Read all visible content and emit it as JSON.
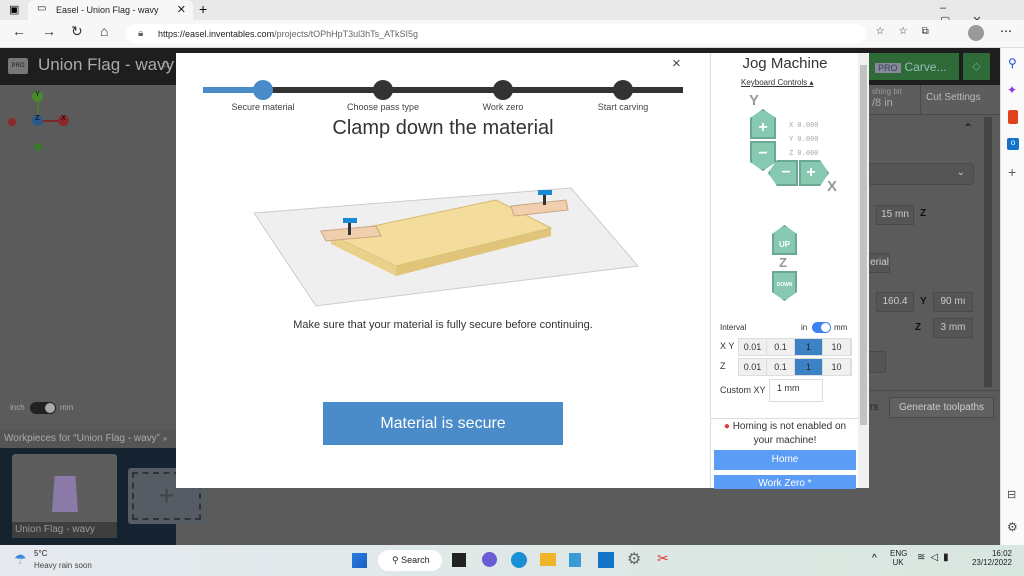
{
  "browser": {
    "tab_title": "Easel - Union Flag - wavy",
    "url_host": "https://easel.inventables.com",
    "url_path": "/projects/tOPhHpT3ul3hTs_ATkSI5g"
  },
  "app": {
    "project_title": "Union Flag - wavy",
    "pro_badge": "PRO",
    "carve_label": "Carve...",
    "bit_label": "shing bit",
    "bit_value": "/8 in",
    "cut_settings": "Cut Settings",
    "depth_value": "15 mn",
    "z_label": "Z",
    "material_label": "erial",
    "x_value": "160.4",
    "y_label": "Y",
    "y_value": "90 mı",
    "z_value": "3 mm",
    "generate_toolpaths": "Generate toolpaths",
    "units_inch": "inch",
    "units_mm": "mm",
    "workpieces_label": "Workpieces for “Union Flag - wavy”",
    "workpiece_name": "Union Flag - wavy",
    "axes": {
      "x": "X",
      "y": "Y",
      "z": "Z"
    }
  },
  "modal": {
    "steps": [
      "Secure material",
      "Choose pass type",
      "Work zero",
      "Start carving"
    ],
    "active_step": 1,
    "title": "Clamp down the material",
    "instructions": "Make sure that your material is fully secure before continuing.",
    "confirm_button": "Material is secure",
    "close": "×"
  },
  "jog": {
    "title": "Jog Machine",
    "keyboard_controls": "Keyboard Controls",
    "y_axis": "Y",
    "x_axis": "X",
    "z_axis": "Z",
    "coords": [
      "X 0.000",
      "Y 0.000",
      "Z 0.000"
    ],
    "plus": "+",
    "minus": "−",
    "up": "UP",
    "down": "DOWN",
    "interval_label": "Interval",
    "unit_in": "in",
    "unit_mm": "mm",
    "unit_selected": "mm",
    "xy_label": "X Y",
    "z_label": "Z",
    "intervals": [
      "0.01",
      "0.1",
      "1",
      "10"
    ],
    "selected_interval": "1",
    "custom_xy_label": "Custom XY",
    "custom_xy_value": "1 mm",
    "homing_warning": "Homing is not enabled on your machine!",
    "home_button": "Home",
    "work_zero_button": "Work Zero *"
  },
  "taskbar": {
    "temp": "5°C",
    "weather": "Heavy rain soon",
    "search": "Search",
    "lang": "ENG",
    "region": "UK",
    "time": "16:02",
    "date": "23/12/2022"
  },
  "colors": {
    "accent": "#4a8cc9",
    "jog_green": "#86c8b0",
    "carve_green": "#2e7d3e",
    "home_blue": "#5b9cf6"
  }
}
